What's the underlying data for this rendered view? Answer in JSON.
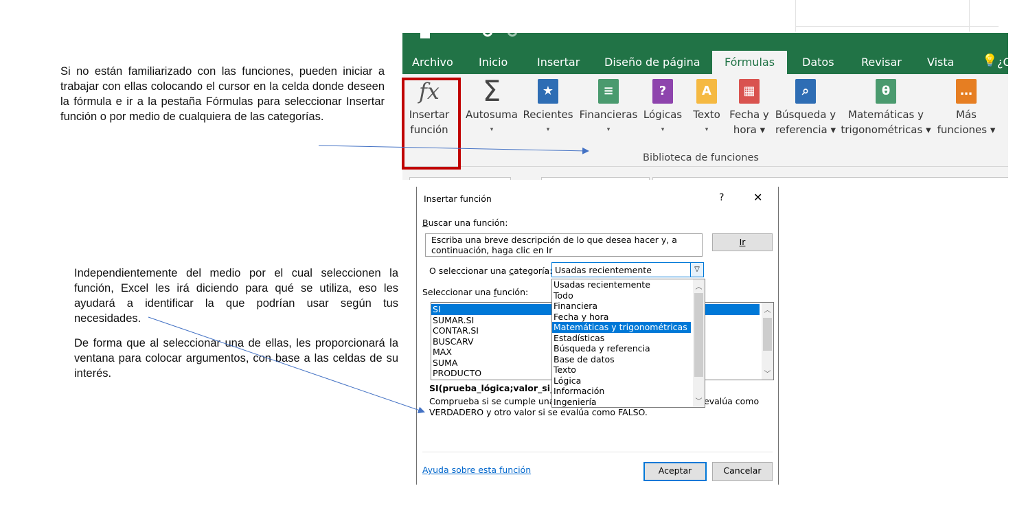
{
  "instructions": {
    "top": "Si no están familiarizado con las funciones, pueden iniciar a trabajar con ellas colocando el cursor en la celda donde deseen la fórmula e ir a la pestaña Fórmulas para seleccionar Insertar función o por medio de cualquiera de las categorías.",
    "middle": "Independientemente del medio por el cual seleccionen la función, Excel les irá diciendo para qué se utiliza, eso les ayudará a identificar la que podrían usar según tus necesidades.",
    "bottom": "De forma que al seleccionar una de ellas, les proporcionará la ventana para colocar argumentos, con base a las celdas de su interés."
  },
  "ribbon": {
    "tabs": [
      "Archivo",
      "Inicio",
      "Insertar",
      "Diseño de página",
      "Fórmulas",
      "Datos",
      "Revisar",
      "Vista"
    ],
    "active_tab": "Fórmulas",
    "tell_me": "¿Q",
    "buttons": [
      {
        "line1": "Insertar",
        "line2": "función",
        "icon": "fx-icon"
      },
      {
        "line1": "Autosuma",
        "line2": "▾",
        "icon": "sigma-icon"
      },
      {
        "line1": "Recientes",
        "line2": "▾",
        "icon": "star-book-icon"
      },
      {
        "line1": "Financieras",
        "line2": "▾",
        "icon": "money-book-icon"
      },
      {
        "line1": "Lógicas",
        "line2": "▾",
        "icon": "question-book-icon"
      },
      {
        "line1": "Texto",
        "line2": "▾",
        "icon": "text-book-icon"
      },
      {
        "line1": "Fecha y",
        "line2": "hora ▾",
        "icon": "calendar-book-icon"
      },
      {
        "line1": "Búsqueda y",
        "line2": "referencia ▾",
        "icon": "search-book-icon"
      },
      {
        "line1": "Matemáticas y",
        "line2": "trigonométricas ▾",
        "icon": "theta-book-icon"
      },
      {
        "line1": "Más",
        "line2": "funciones ▾",
        "icon": "more-book-icon"
      }
    ],
    "group_label": "Biblioteca de funciones",
    "colors": {
      "excel_green": "#217346",
      "highlight_red": "#c00000"
    }
  },
  "dialog": {
    "title": "Insertar función",
    "help_glyph": "?",
    "close_glyph": "✕",
    "search_label_prefix": "B",
    "search_label_rest": "uscar una función:",
    "search_text_line1": "Escriba una breve descripción de lo que desea hacer y, a",
    "search_text_line2": "continuación, haga clic en Ir",
    "go_button": "Ir",
    "category_label_a": "O seleccionar una ",
    "category_label_u": "c",
    "category_label_b": "ategoría:",
    "category_value": "Usadas recientemente",
    "category_options": [
      "Usadas recientemente",
      "Todo",
      "Financiera",
      "Fecha y hora",
      "Matemáticas y trigonométricas",
      "Estadísticas",
      "Búsqueda y referencia",
      "Base de datos",
      "Texto",
      "Lógica",
      "Información",
      "Ingeniería"
    ],
    "category_selected_index": 4,
    "function_label_a": "Seleccionar una ",
    "function_label_u": "f",
    "function_label_b": "unción:",
    "functions": [
      "SI",
      "SUMAR.SI",
      "CONTAR.SI",
      "BUSCARV",
      "MAX",
      "SUMA",
      "PRODUCTO"
    ],
    "function_selected_index": 0,
    "signature": "SI(prueba_lógica;valor_si_ver",
    "description_line1_a": "Comprueba si se cumple una",
    "description_line1_b": "evalúa como",
    "description_line2": "VERDADERO y otro valor si se evalúa como FALSO.",
    "help_link": "Ayuda sobre esta función",
    "ok_button": "Aceptar",
    "cancel_button": "Cancelar"
  }
}
